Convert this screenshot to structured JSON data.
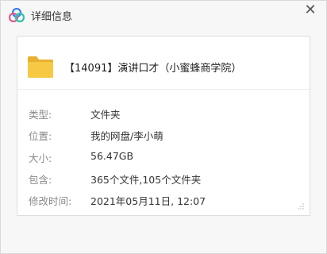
{
  "window": {
    "title": "详细信息",
    "title_icon": "app-logo-icon",
    "close_glyph": "✕"
  },
  "file": {
    "icon": "folder-icon",
    "name": "【14091】演讲口才（小蜜蜂商学院）"
  },
  "details": [
    {
      "label": "类型:",
      "value": "文件夹"
    },
    {
      "label": "位置:",
      "value": "我的网盘/李小萌"
    },
    {
      "label": "大小:",
      "value": "56.47GB"
    },
    {
      "label": "包含:",
      "value": "365个文件,105个文件夹"
    },
    {
      "label": "修改时间:",
      "value": "2021年05月11日, 12:07"
    }
  ],
  "colors": {
    "folder_yellow": "#f7c843",
    "logo_blue": "#3b7ff0",
    "logo_pink": "#e45a8f",
    "logo_green": "#2cc3a6"
  }
}
